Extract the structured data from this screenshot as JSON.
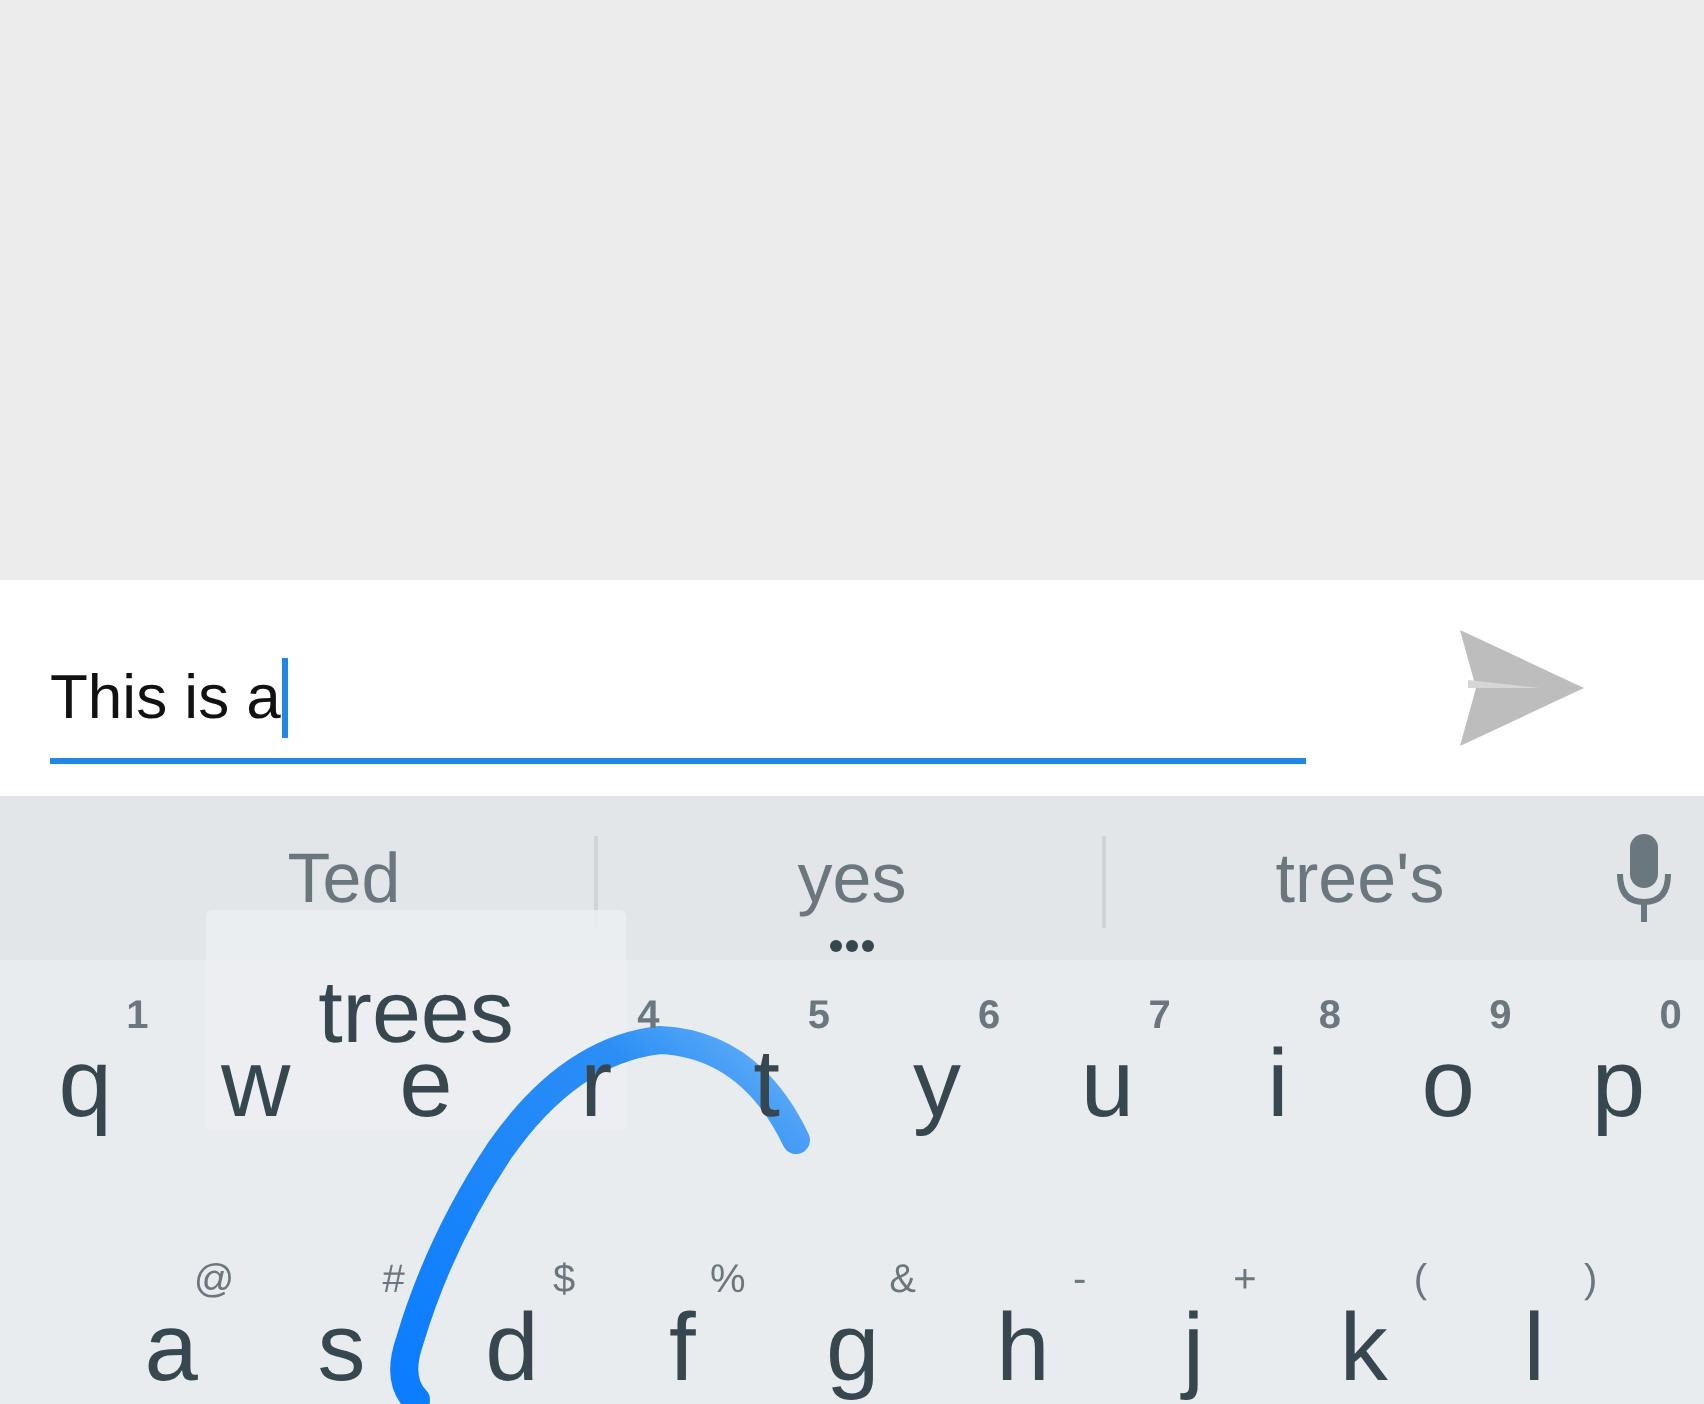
{
  "message": {
    "value": "This is a",
    "focused": true
  },
  "suggestions": [
    {
      "text": "Ted",
      "has_more": false
    },
    {
      "text": "yes",
      "has_more": true
    },
    {
      "text": "tree's",
      "has_more": false
    }
  ],
  "gesture_preview": {
    "text": "trees"
  },
  "keyboard": {
    "rows": [
      [
        {
          "label": "q",
          "hint": "1"
        },
        {
          "label": "w"
        },
        {
          "label": "e"
        },
        {
          "label": "r",
          "hint": "4"
        },
        {
          "label": "t",
          "hint": "5"
        },
        {
          "label": "y",
          "hint": "6"
        },
        {
          "label": "u",
          "hint": "7"
        },
        {
          "label": "i",
          "hint": "8"
        },
        {
          "label": "o",
          "hint": "9"
        },
        {
          "label": "p",
          "hint": "0"
        }
      ],
      [
        {
          "label": "a",
          "hint": "@"
        },
        {
          "label": "s",
          "hint": "#"
        },
        {
          "label": "d",
          "hint": "$"
        },
        {
          "label": "f",
          "hint": "%"
        },
        {
          "label": "g",
          "hint": "&"
        },
        {
          "label": "h",
          "hint": "-"
        },
        {
          "label": "j",
          "hint": "+"
        },
        {
          "label": "k",
          "hint": "("
        },
        {
          "label": "l",
          "hint": ")"
        }
      ]
    ]
  }
}
